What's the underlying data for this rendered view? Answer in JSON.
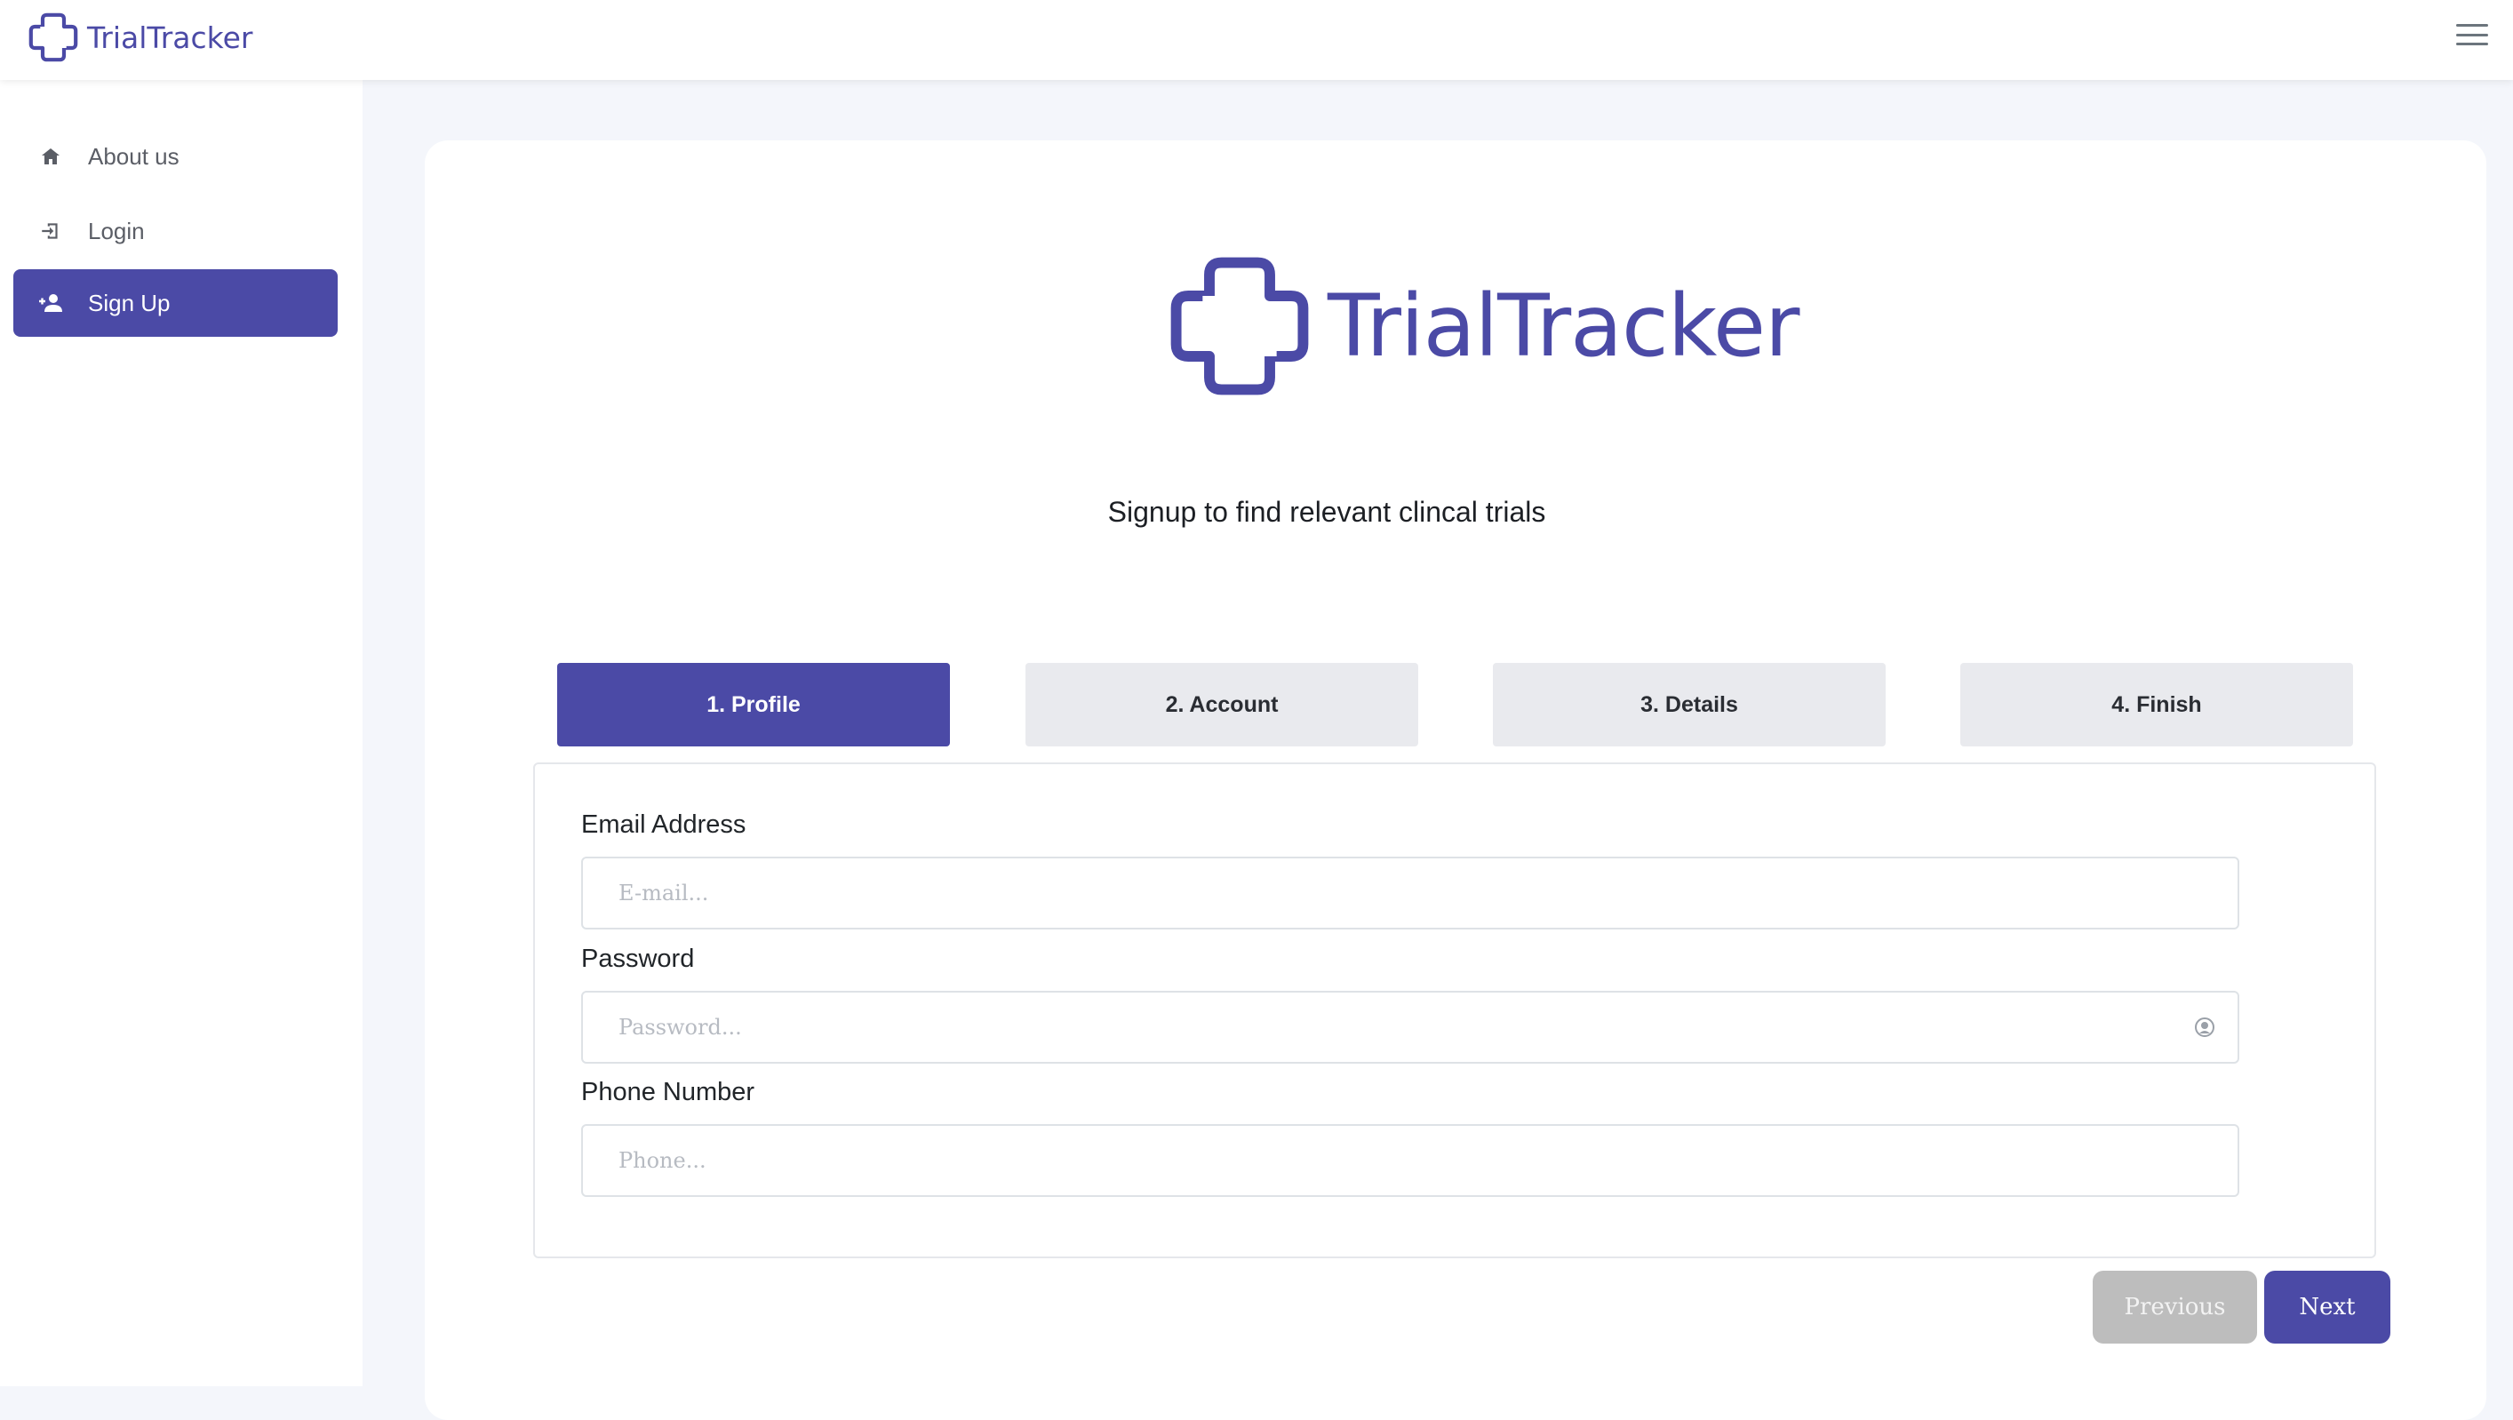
{
  "app": {
    "brand_name": "TrialTracker"
  },
  "colors": {
    "accent": "#4b4aa6",
    "inactive_step": "#e9eaee",
    "prev_button": "#bdbdbd"
  },
  "sidebar": {
    "items": [
      {
        "label": "About us",
        "icon": "home-icon",
        "active": false
      },
      {
        "label": "Login",
        "icon": "login-icon",
        "active": false
      },
      {
        "label": "Sign Up",
        "icon": "user-plus-icon",
        "active": true
      }
    ]
  },
  "main": {
    "logo_text": "TrialTracker",
    "subtitle": "Signup to find relevant clincal trials",
    "steps": [
      {
        "label": "1. Profile",
        "active": true
      },
      {
        "label": "2. Account",
        "active": false
      },
      {
        "label": "3. Details",
        "active": false
      },
      {
        "label": "4. Finish",
        "active": false
      }
    ],
    "form": {
      "email": {
        "label": "Email Address",
        "placeholder": "E-mail...",
        "value": ""
      },
      "password": {
        "label": "Password",
        "placeholder": "Password...",
        "value": ""
      },
      "phone": {
        "label": "Phone Number",
        "placeholder": "Phone...",
        "value": ""
      }
    },
    "buttons": {
      "previous": "Previous",
      "next": "Next"
    }
  }
}
